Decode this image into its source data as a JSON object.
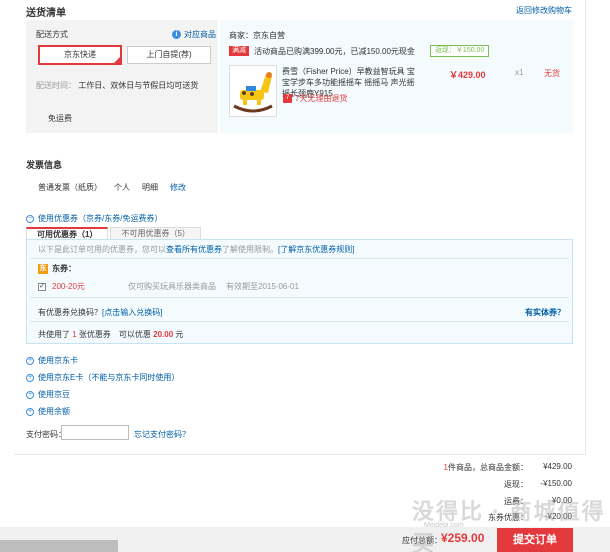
{
  "header": {
    "title": "送货清单",
    "return_link": "返回修改购物车"
  },
  "shipping": {
    "label": "配送方式",
    "help": "对应商品",
    "option_jd": "京东快递",
    "option_self": "上门自提(荐)",
    "time_label": "配送时间：",
    "time_value": "工作日、双休日与节假日均可送货",
    "free_ship": "免运费"
  },
  "seller": {
    "name": "商家：京东自营",
    "promo_tag": "满减",
    "promo_text": "活动商品已购满399.00元，已减150.00元现金",
    "promo_saved": "返现：￥150.00",
    "product_name": "费雪（Fisher Price）早教益智玩具 宝宝学步车多功能摇摇车 摇摇马 声光摇摇长颈鹿Y915",
    "product_price": "￥429.00",
    "product_qty": "x1",
    "product_stock": "无货",
    "return_icon": "7",
    "return_policy": "7天无理由退货"
  },
  "invoice": {
    "title": "发票信息",
    "type": "普通发票（纸质）",
    "holder": "个人",
    "content": "明细",
    "edit": "修改"
  },
  "coupon": {
    "head": "使用优惠券（京券/东券/免运费券）",
    "tab_usable": "可用优惠券（1）",
    "tab_unusable": "不可用优惠券（5）",
    "tip_pre": "以下是此订单可用的优惠券，您可以",
    "tip_link1": "查看所有优惠券",
    "tip_mid": "了解使用限制。",
    "tip_link2": "[了解京东优惠券规则]",
    "dong_icon": "东",
    "dong_label": "东券：",
    "check": "✓",
    "item_amount": "200-20元",
    "item_desc": "仅可购买玩具乐器类商品",
    "item_expire": "有效期至2015-06-01",
    "code_pre": "有优惠券兑换码？",
    "code_link": "[点击输入兑换码]",
    "real_coupon": "有实体券？",
    "sum_pre": "共使用了",
    "sum_count": "1",
    "sum_mid": "张优惠券　可以优惠",
    "sum_amount": "20.00",
    "sum_unit": "元"
  },
  "use_options": {
    "jdcard": "使用京东卡",
    "jdecard": "使用京东E卡（不能与京东卡同时使用）",
    "jdbean": "使用京豆",
    "balance": "使用余额"
  },
  "payment": {
    "pwd_label": "支付密码：",
    "forgot": "忘记支付密码？"
  },
  "totals": {
    "items_count": "1",
    "items_label": "件商品，总商品金额：",
    "items_value": "¥429.00",
    "cashback_label": "返现：",
    "cashback_value": "-¥150.00",
    "freight_label": "运费：",
    "freight_value": "¥0.00",
    "coupon_label": "东券优惠：",
    "coupon_value": "-¥20.00",
    "pay_label": "应付总额：",
    "pay_value": "¥259.00",
    "submit": "提交订单"
  },
  "watermark": {
    "text": "没得比 · 商城值得买",
    "url": "Meidebi.com"
  },
  "colors": {
    "accent_red": "#e4393c",
    "link_blue": "#005ea7",
    "panel_blue": "#f3fbfe"
  }
}
